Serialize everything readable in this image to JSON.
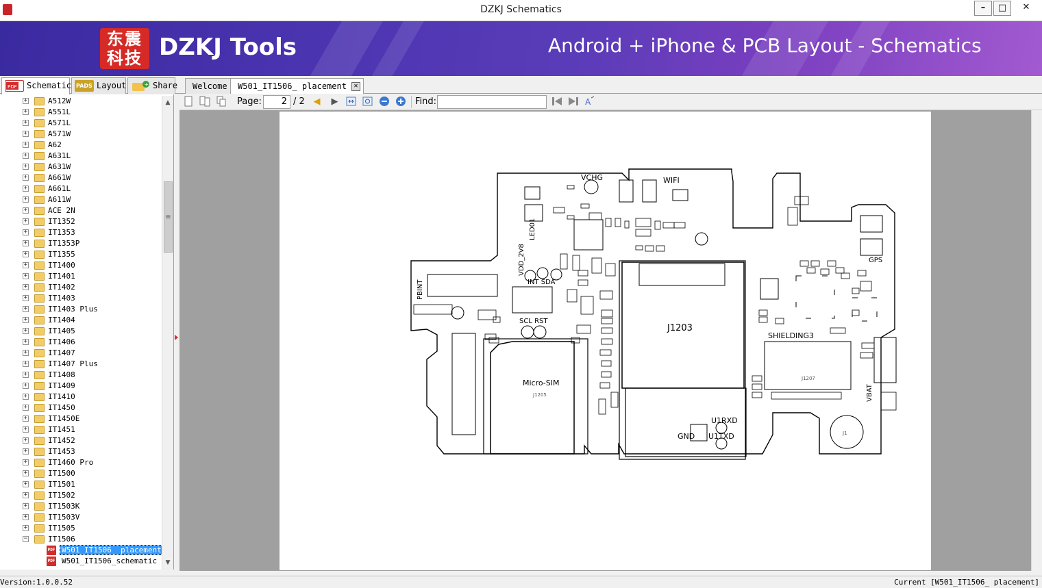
{
  "window": {
    "title": "DZKJ Schematics",
    "minimize": "–",
    "maximize": "□",
    "close": "✕"
  },
  "banner": {
    "logo_text": "东震\n科技",
    "brand": "DZKJ Tools",
    "tagline": "Android + iPhone & PCB Layout - Schematics"
  },
  "side_tabs": [
    {
      "label": "Schematic",
      "icon": "pdf-icon",
      "active": true
    },
    {
      "label": "Layout",
      "icon": "pads-icon",
      "active": false
    },
    {
      "label": "Share",
      "icon": "share-icon",
      "active": false
    }
  ],
  "doc_tabs": [
    {
      "label": "Welcome",
      "active": false
    },
    {
      "label": "W501_IT1506_ placement",
      "active": true
    }
  ],
  "tree": {
    "folders": [
      "A512W",
      "A551L",
      "A571L",
      "A571W",
      "A62",
      "A631L",
      "A631W",
      "A661W",
      "A661L",
      "A611W",
      "ACE 2N",
      "IT1352",
      "IT1353",
      "IT1353P",
      "IT1355",
      "IT1400",
      "IT1401",
      "IT1402",
      "IT1403",
      "IT1403 Plus",
      "IT1404",
      "IT1405",
      "IT1406",
      "IT1407",
      "IT1407 Plus",
      "IT1408",
      "IT1409",
      "IT1410",
      "IT1450",
      "IT1450E",
      "IT1451",
      "IT1452",
      "IT1453",
      "IT1460 Pro",
      "IT1500",
      "IT1501",
      "IT1502",
      "IT1503K",
      "IT1503V",
      "IT1505",
      "IT1506"
    ],
    "files": [
      {
        "label": "W501_IT1506_ placement",
        "selected": true
      },
      {
        "label": "W501_IT1506_schematic",
        "selected": false
      }
    ]
  },
  "toolbar": {
    "page_label": "Page:",
    "page_current": "2",
    "page_total": "/ 2",
    "find_label": "Find:",
    "find_value": ""
  },
  "board": {
    "labels": {
      "vchg": "VCHG",
      "wifi": "WIFI",
      "led": "LED01",
      "vdd": "VDD_2V8",
      "int_sda": "INT SDA",
      "pbint": "PBINT",
      "scl_rst": "SCL RST",
      "gps": "GPS",
      "j1203": "J1203",
      "shielding": "SHIELDING3",
      "microsim": "Micro-SIM",
      "j1205": "J1205",
      "vbat": "VBAT",
      "u1rxd": "U1RXD",
      "u1txd": "U1TXD",
      "gnd": "GND",
      "j1207": "J1207",
      "j1": "J1"
    }
  },
  "status": {
    "version": "Version:1.0.0.52",
    "current": "Current [W501_IT1506_ placement]"
  }
}
